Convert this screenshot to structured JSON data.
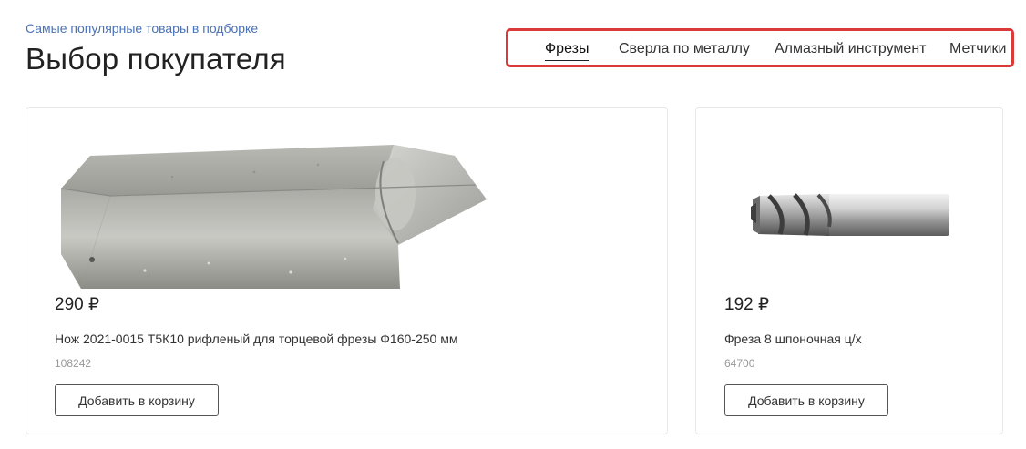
{
  "header": {
    "subtitle": "Самые популярные товары в подборке",
    "title": "Выбор покупателя"
  },
  "tabs": [
    {
      "label": "Фрезы",
      "active": true
    },
    {
      "label": "Сверла по металлу",
      "active": false
    },
    {
      "label": "Алмазный инструмент",
      "active": false
    },
    {
      "label": "Метчики",
      "active": false
    }
  ],
  "highlight_color": "#d93a3a",
  "accent_color": "#4a72b8",
  "products": [
    {
      "price": "290 ₽",
      "name": "Нож 2021-0015 Т5К10 рифленый для торцевой фрезы Ф160-250 мм",
      "sku": "108242",
      "button_label": "Добавить в корзину",
      "image": "carbide-knife-blade-image"
    },
    {
      "price": "192 ₽",
      "name": "Фреза 8 шпоночная ц/х",
      "sku": "64700",
      "button_label": "Добавить в корзину",
      "image": "end-mill-cutter-image"
    }
  ]
}
